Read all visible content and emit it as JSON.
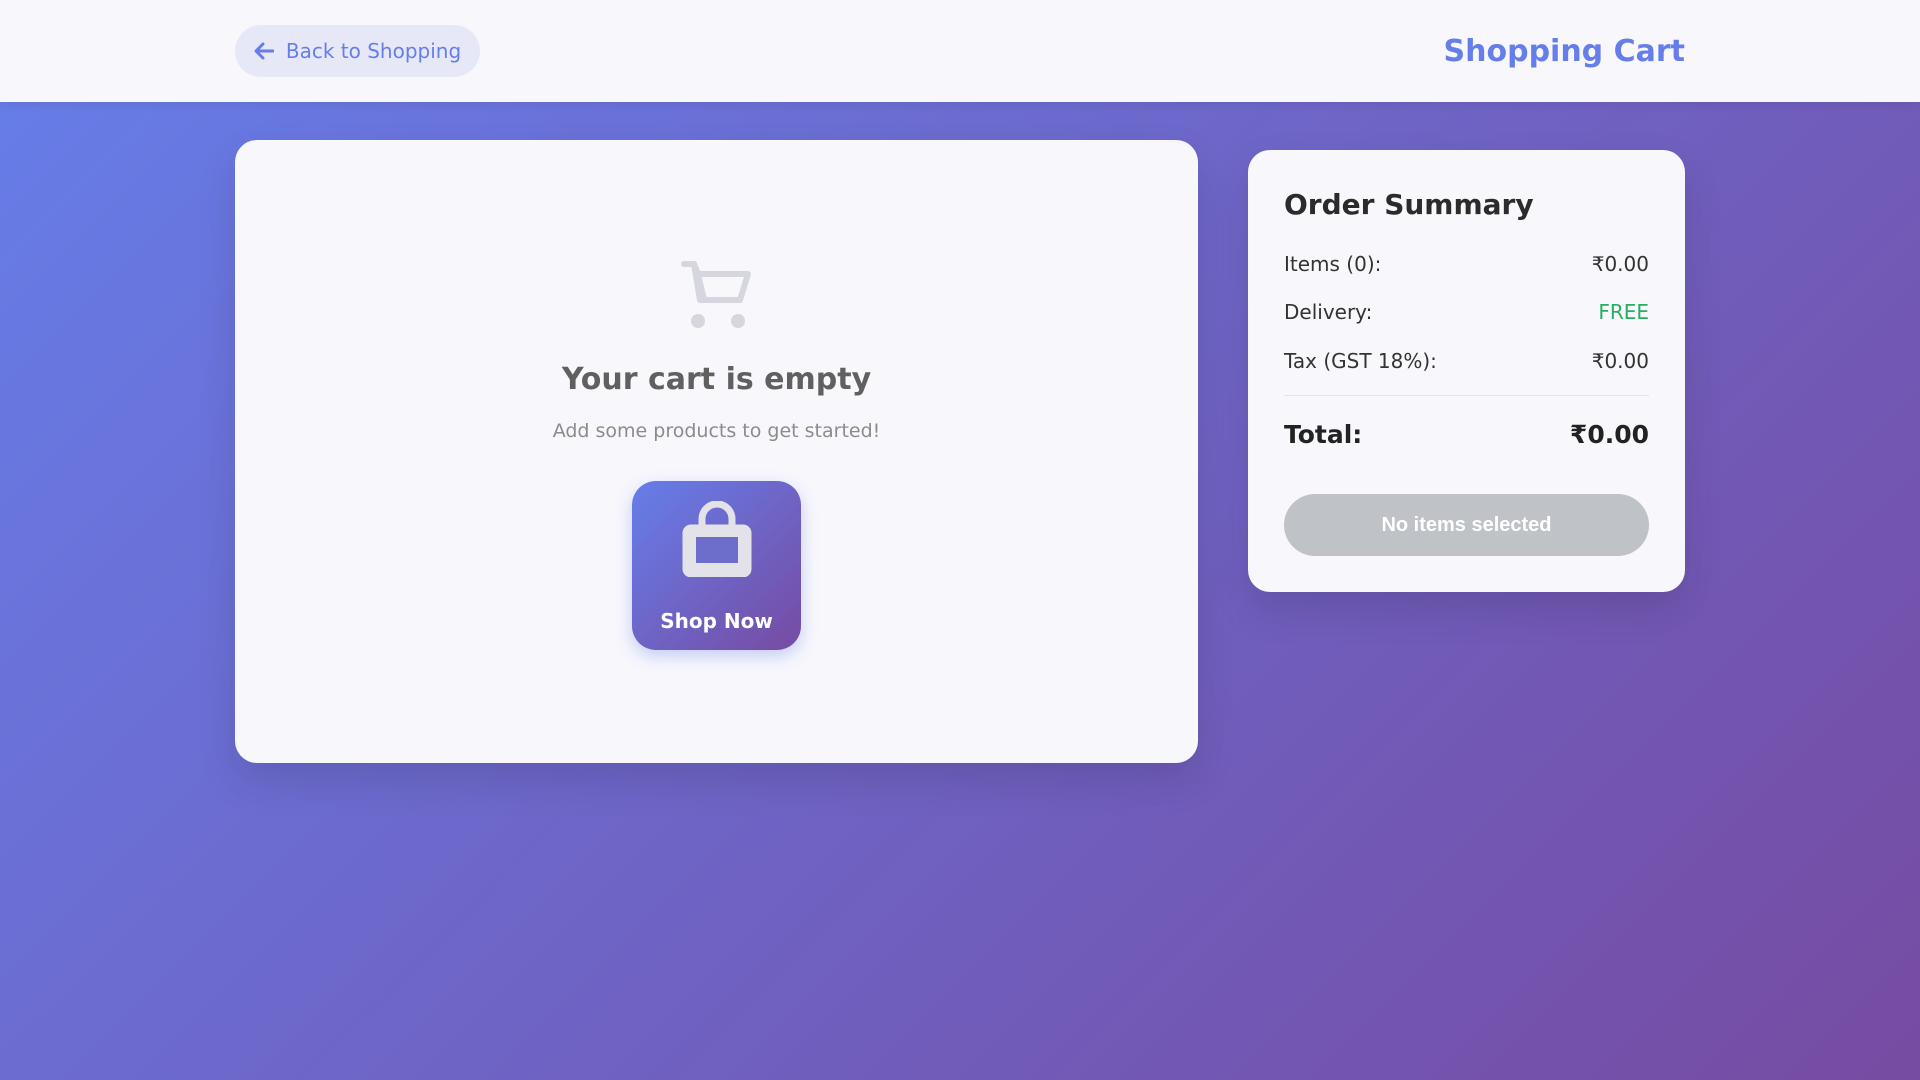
{
  "header": {
    "back_label": "Back to Shopping",
    "title": "Shopping Cart"
  },
  "cart": {
    "empty_title": "Your cart is empty",
    "empty_subtitle": "Add some products to get started!",
    "shop_button_label": "Shop Now",
    "empty_icon": "cart-icon",
    "shop_icon": "shopping-bag-icon"
  },
  "summary": {
    "title": "Order Summary",
    "items_label": "Items (0):",
    "items_value": "₹0.00",
    "delivery_label": "Delivery:",
    "delivery_value": "FREE",
    "tax_label": "Tax (GST 18%):",
    "tax_value": "₹0.00",
    "total_label": "Total:",
    "total_value": "₹0.00",
    "checkout_label": "No items selected"
  },
  "colors": {
    "accent": "#667eea",
    "gradient_start": "#667eea",
    "gradient_end": "#764ba2",
    "free": "#27ae60",
    "disabled_button": "#bfc3c8"
  }
}
